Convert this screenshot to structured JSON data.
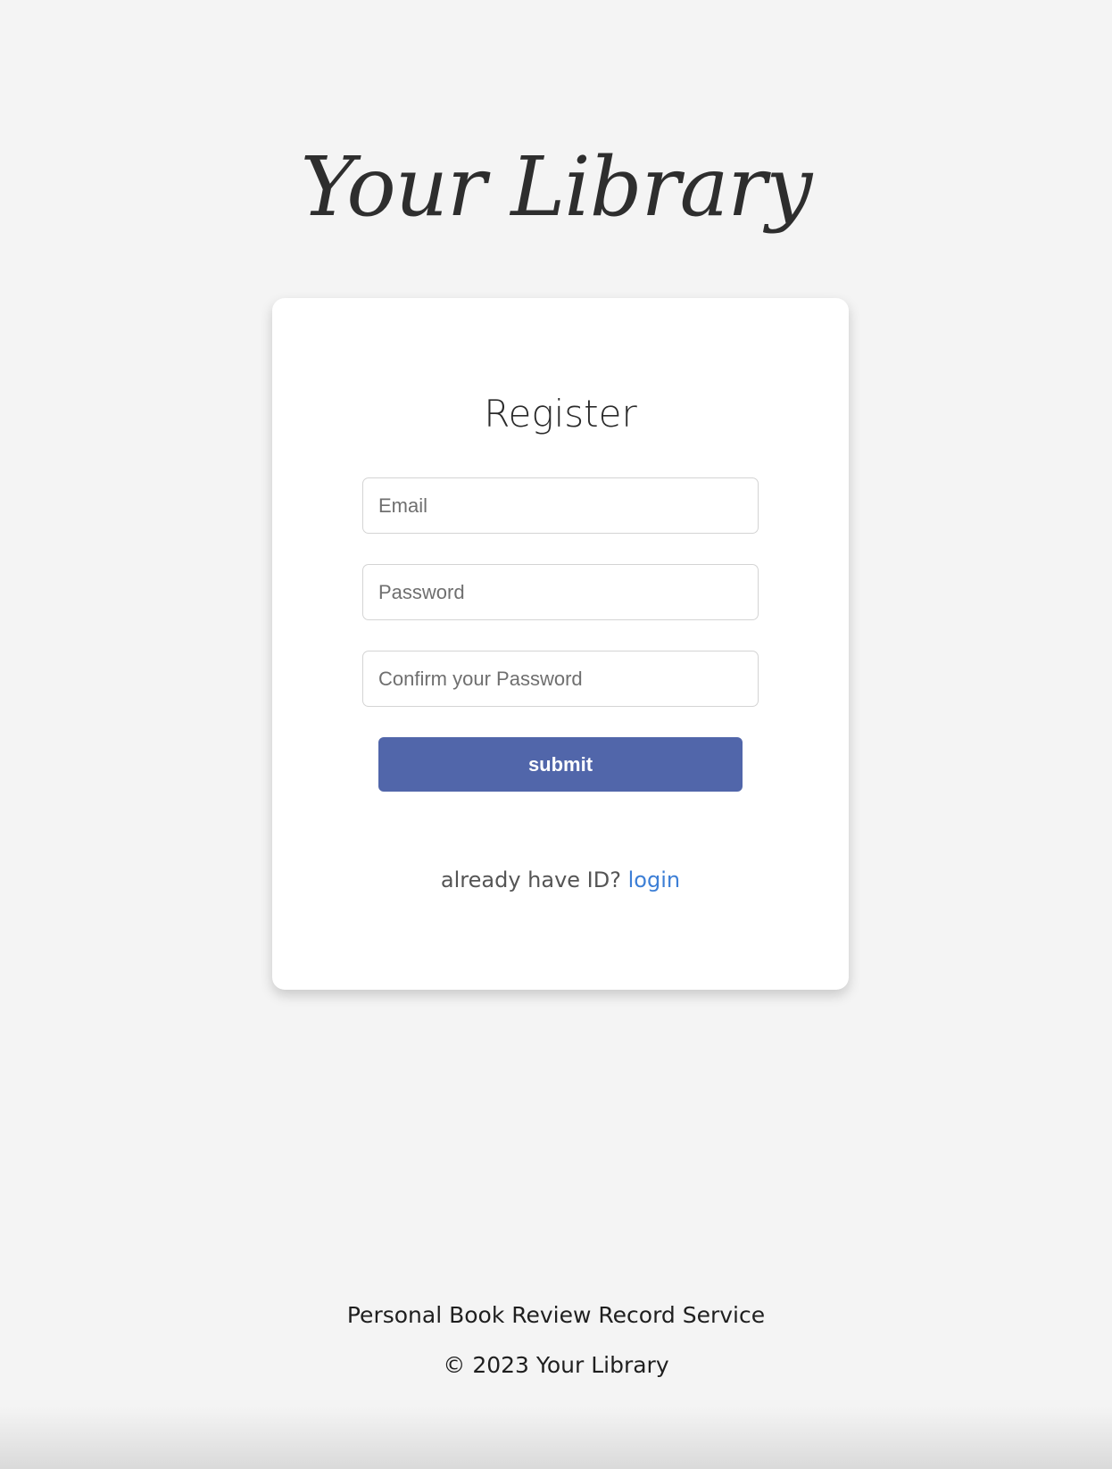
{
  "header": {
    "logo_text": "Your Library"
  },
  "register": {
    "title": "Register",
    "email_placeholder": "Email",
    "password_placeholder": "Password",
    "confirm_placeholder": "Confirm your Password",
    "submit_label": "submit",
    "login_prompt": "already have ID?",
    "login_link": "login"
  },
  "footer": {
    "tagline": "Personal Book Review Record Service",
    "copyright": "© 2023 Your Library"
  },
  "colors": {
    "background": "#f4f4f4",
    "card": "#ffffff",
    "submit_button": "#5166aa",
    "link": "#3d7fd6"
  }
}
